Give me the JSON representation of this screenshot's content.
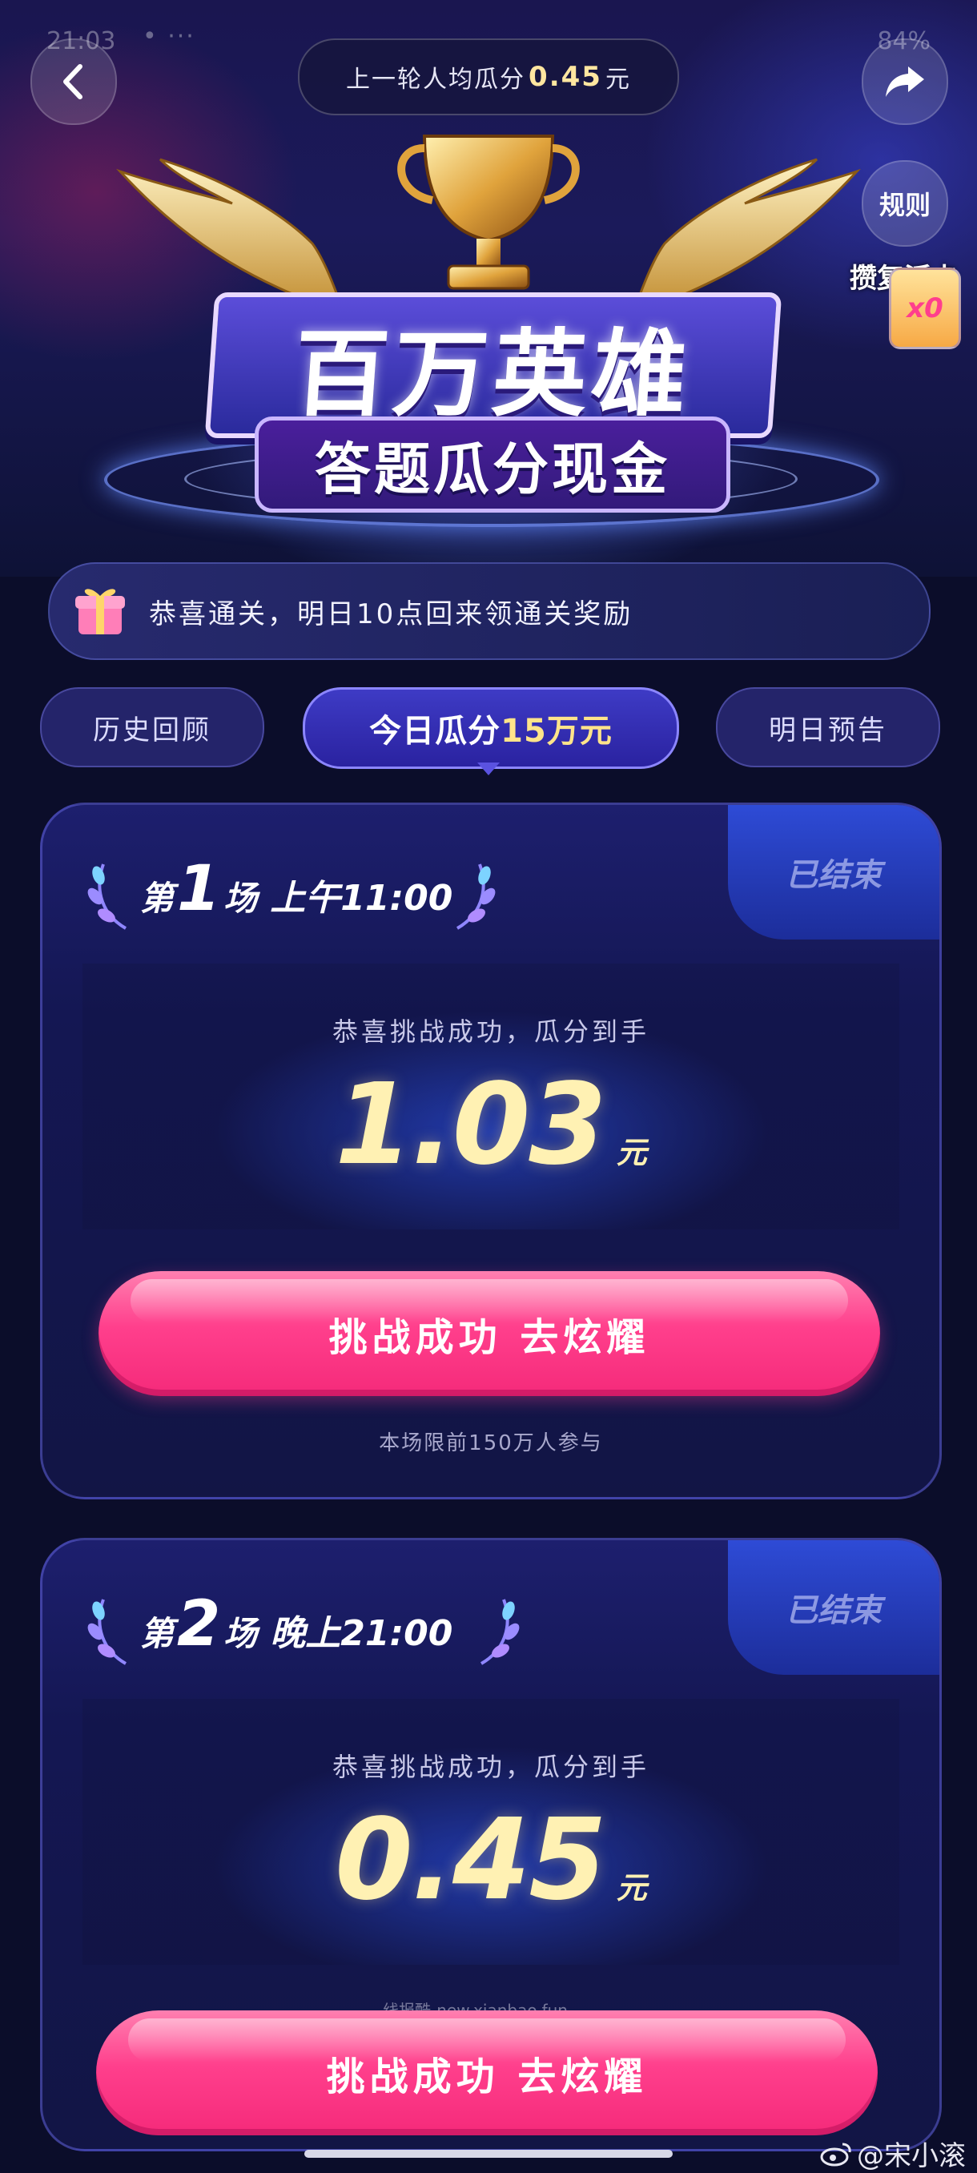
{
  "status_bar": {
    "time": "21:03",
    "dots": "• ···",
    "right": "84%"
  },
  "header": {
    "last_round_prefix": "上一轮人均瓜分",
    "last_round_amount": "0.45",
    "last_round_unit": "元",
    "rules_label": "规则",
    "revive_count": "x0",
    "revive_label": "攒复活卡"
  },
  "hero": {
    "title": "百万英雄",
    "subtitle": "答题瓜分现金"
  },
  "notice": {
    "text": "恭喜通关，明日10点回来领通关奖励"
  },
  "tabs": [
    {
      "label": "历史回顾"
    },
    {
      "label_prefix": "今日瓜分",
      "label_highlight": "15万元"
    },
    {
      "label": "明日预告"
    }
  ],
  "sessions": [
    {
      "di": "第",
      "num": "1",
      "chang": "场",
      "time": "上午11:00",
      "status": "已结束",
      "congrats": "恭喜挑战成功，瓜分到手",
      "amount": "1.03",
      "unit": "元",
      "cta": "挑战成功 去炫耀",
      "limit": "本场限前150万人参与"
    },
    {
      "di": "第",
      "num": "2",
      "chang": "场",
      "time": "晚上21:00",
      "status": "已结束",
      "congrats": "恭喜挑战成功，瓜分到手",
      "amount": "0.45",
      "unit": "元",
      "cta": "挑战成功 去炫耀"
    }
  ],
  "watermark": "线报酷-new.xianbao.fun",
  "weibo_user": "@宋小滚",
  "icons": {
    "back": "chevron-left-icon",
    "share": "share-arrow-icon",
    "gift": "gift-box-icon",
    "laurel": "laurel-icon",
    "trophy": "trophy-icon",
    "wing": "wing-icon",
    "weibo": "weibo-logo-icon"
  },
  "colors": {
    "background": "#0b0d2a",
    "accent_gold": "#ffe48a",
    "cta_pink": "#ff3f8c",
    "tab_active": "#3e3bc5"
  }
}
